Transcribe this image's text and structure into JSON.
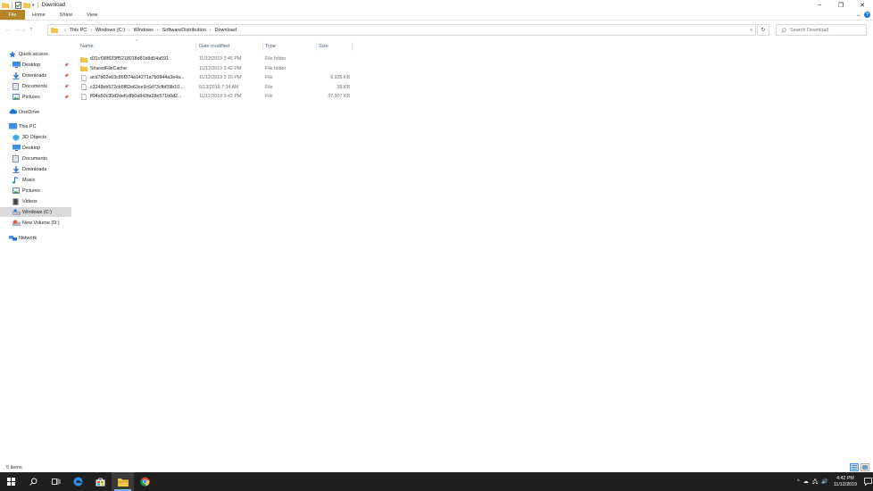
{
  "window": {
    "title": "Download",
    "controls": {
      "minimize": "–",
      "restore": "❐",
      "close": "✕"
    }
  },
  "ribbon": {
    "tabs": [
      "File",
      "Home",
      "Share",
      "View"
    ],
    "help": "?"
  },
  "address": {
    "breadcrumbs": [
      "This PC",
      "Windows (C:)",
      "Windows",
      "SoftwareDistribution",
      "Download"
    ]
  },
  "search": {
    "placeholder": "Search Download"
  },
  "nav": {
    "items": [
      {
        "label": "Quick access",
        "icon": "star-icon",
        "pinned": false
      },
      {
        "label": "Desktop",
        "icon": "desktop-icon",
        "pinned": true
      },
      {
        "label": "Downloads",
        "icon": "download-arrow-icon",
        "pinned": true
      },
      {
        "label": "Documents",
        "icon": "documents-icon",
        "pinned": true
      },
      {
        "label": "Pictures",
        "icon": "pictures-icon",
        "pinned": true
      },
      {
        "label": "OneDrive",
        "icon": "cloud-icon",
        "pinned": false
      },
      {
        "label": "This PC",
        "icon": "computer-icon",
        "pinned": false
      },
      {
        "label": "3D Objects",
        "icon": "cube-icon",
        "pinned": false
      },
      {
        "label": "Desktop",
        "icon": "desktop-icon",
        "pinned": false
      },
      {
        "label": "Documents",
        "icon": "documents-icon",
        "pinned": false
      },
      {
        "label": "Downloads",
        "icon": "download-arrow-icon",
        "pinned": false
      },
      {
        "label": "Music",
        "icon": "music-note-icon",
        "pinned": false
      },
      {
        "label": "Pictures",
        "icon": "pictures-icon",
        "pinned": false
      },
      {
        "label": "Videos",
        "icon": "film-icon",
        "pinned": false
      },
      {
        "label": "Windows (C:)",
        "icon": "drive-icon",
        "pinned": false
      },
      {
        "label": "New Volume (D:)",
        "icon": "drive-removable-icon",
        "pinned": false
      },
      {
        "label": "Network",
        "icon": "network-icon",
        "pinned": false
      }
    ],
    "selected": "Windows (C:)"
  },
  "columns": [
    "Name",
    "Date modified",
    "Type",
    "Size"
  ],
  "files": [
    {
      "name": "d31cf38f633ff5218018d81b8d54a591",
      "date": "11/12/2019 3:45 PM",
      "type": "File folder",
      "size": "",
      "kind": "folder"
    },
    {
      "name": "SharedFileCache",
      "date": "11/12/2019 3:42 PM",
      "type": "File folder",
      "size": "",
      "kind": "folder"
    },
    {
      "name": "acd7b02e03c86f374a14271a7b0844a3e4a...",
      "date": "11/12/2019 3:16 PM",
      "type": "File",
      "size": "6,935 KB",
      "kind": "file"
    },
    {
      "name": "c3248eb572cb5f82e63ce9c6d73cfbf39b10...",
      "date": "6/13/2019 7:34 AM",
      "type": "File",
      "size": "39 KB",
      "kind": "file"
    },
    {
      "name": "ff94a50c30d2defcdfb0e843fa28e571b0d2...",
      "date": "11/12/2019 3:42 PM",
      "type": "File",
      "size": "37,907 KB",
      "kind": "file"
    }
  ],
  "status": {
    "items_count": "5 items"
  },
  "taskbar": {
    "apps": [
      "start-icon",
      "search-icon",
      "task-view-icon",
      "edge-icon",
      "store-icon",
      "file-explorer-icon",
      "chrome-icon"
    ],
    "active": "file-explorer-icon",
    "time": "4:42 PM",
    "date": "11/12/2019"
  },
  "colors": {
    "file_tab": "#b5852a",
    "selection": "#d9d9d9",
    "taskbar": "#1f1f1f",
    "accent": "#1a73d9",
    "folder": "#f2c34b"
  }
}
